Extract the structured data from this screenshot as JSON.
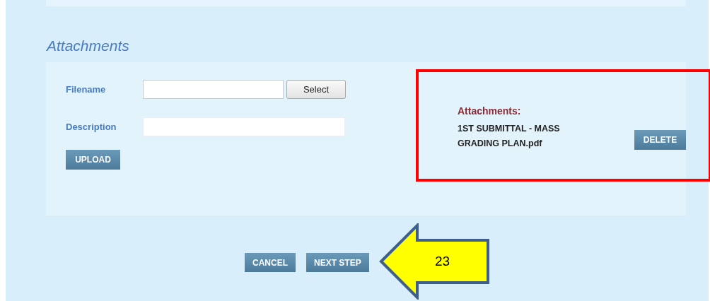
{
  "section_title": "Attachments",
  "fields": [
    {
      "label": "Filename",
      "button": "Select"
    },
    {
      "label": "Description"
    }
  ],
  "upload_button": "UPLOAD",
  "attachments": {
    "heading": "Attachments:",
    "file_lines": [
      "1ST SUBMITTAL - MASS",
      "GRADING PLAN.pdf"
    ],
    "delete_button": "DELETE"
  },
  "footer_buttons": [
    "CANCEL",
    "NEXT STEP"
  ],
  "callout": {
    "label": "23"
  }
}
